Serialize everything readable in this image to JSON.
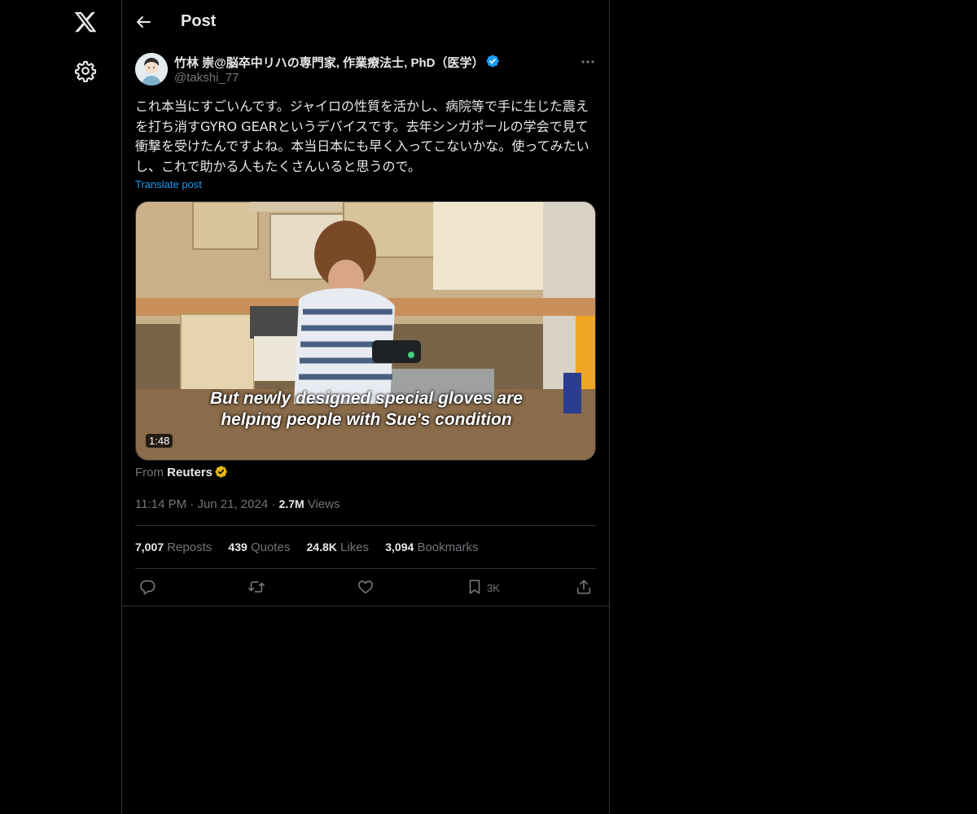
{
  "header": {
    "title": "Post"
  },
  "author": {
    "name": "竹林 崇@脳卒中リハの専門家, 作業療法士, PhD（医学）",
    "handle": "@takshi_77",
    "verified_color": "#1d9bf0"
  },
  "post": {
    "text": "これ本当にすごいんです。ジャイロの性質を活かし、病院等で手に生じた震えを打ち消すGYRO GEARというデバイスです。去年シンガポールの学会で見て衝撃を受けたんですよね。本当日本にも早く入ってこないかな。使ってみたいし、これで助かる人もたくさんいると思うので。",
    "translate_label": "Translate post"
  },
  "video": {
    "caption_line1": "But newly designed special gloves are",
    "caption_line2": "helping people with Sue's condition",
    "duration": "1:48"
  },
  "source": {
    "prefix": "From",
    "name": "Reuters",
    "badge_color": "#e2b719"
  },
  "meta": {
    "time": "11:14 PM",
    "date": "Jun 21, 2024",
    "separator": "·",
    "views_count": "2.7M",
    "views_label": "Views"
  },
  "stats": {
    "reposts": {
      "count": "7,007",
      "label": "Reposts"
    },
    "quotes": {
      "count": "439",
      "label": "Quotes"
    },
    "likes": {
      "count": "24.8K",
      "label": "Likes"
    },
    "bookmarks": {
      "count": "3,094",
      "label": "Bookmarks"
    }
  },
  "actions": {
    "bookmark_count": "3K"
  },
  "icons": {
    "nav": [
      "x-logo-icon",
      "gear-icon"
    ],
    "header": [
      "back-arrow-icon"
    ],
    "post": [
      "verified-icon",
      "more-icon"
    ],
    "actions": [
      "reply-icon",
      "repost-icon",
      "like-icon",
      "bookmark-icon",
      "share-icon"
    ]
  },
  "colors": {
    "background": "#000000",
    "accent": "#1d9bf0",
    "muted": "#71767b",
    "text": "#e7e9ea",
    "border": "#2f3336"
  }
}
